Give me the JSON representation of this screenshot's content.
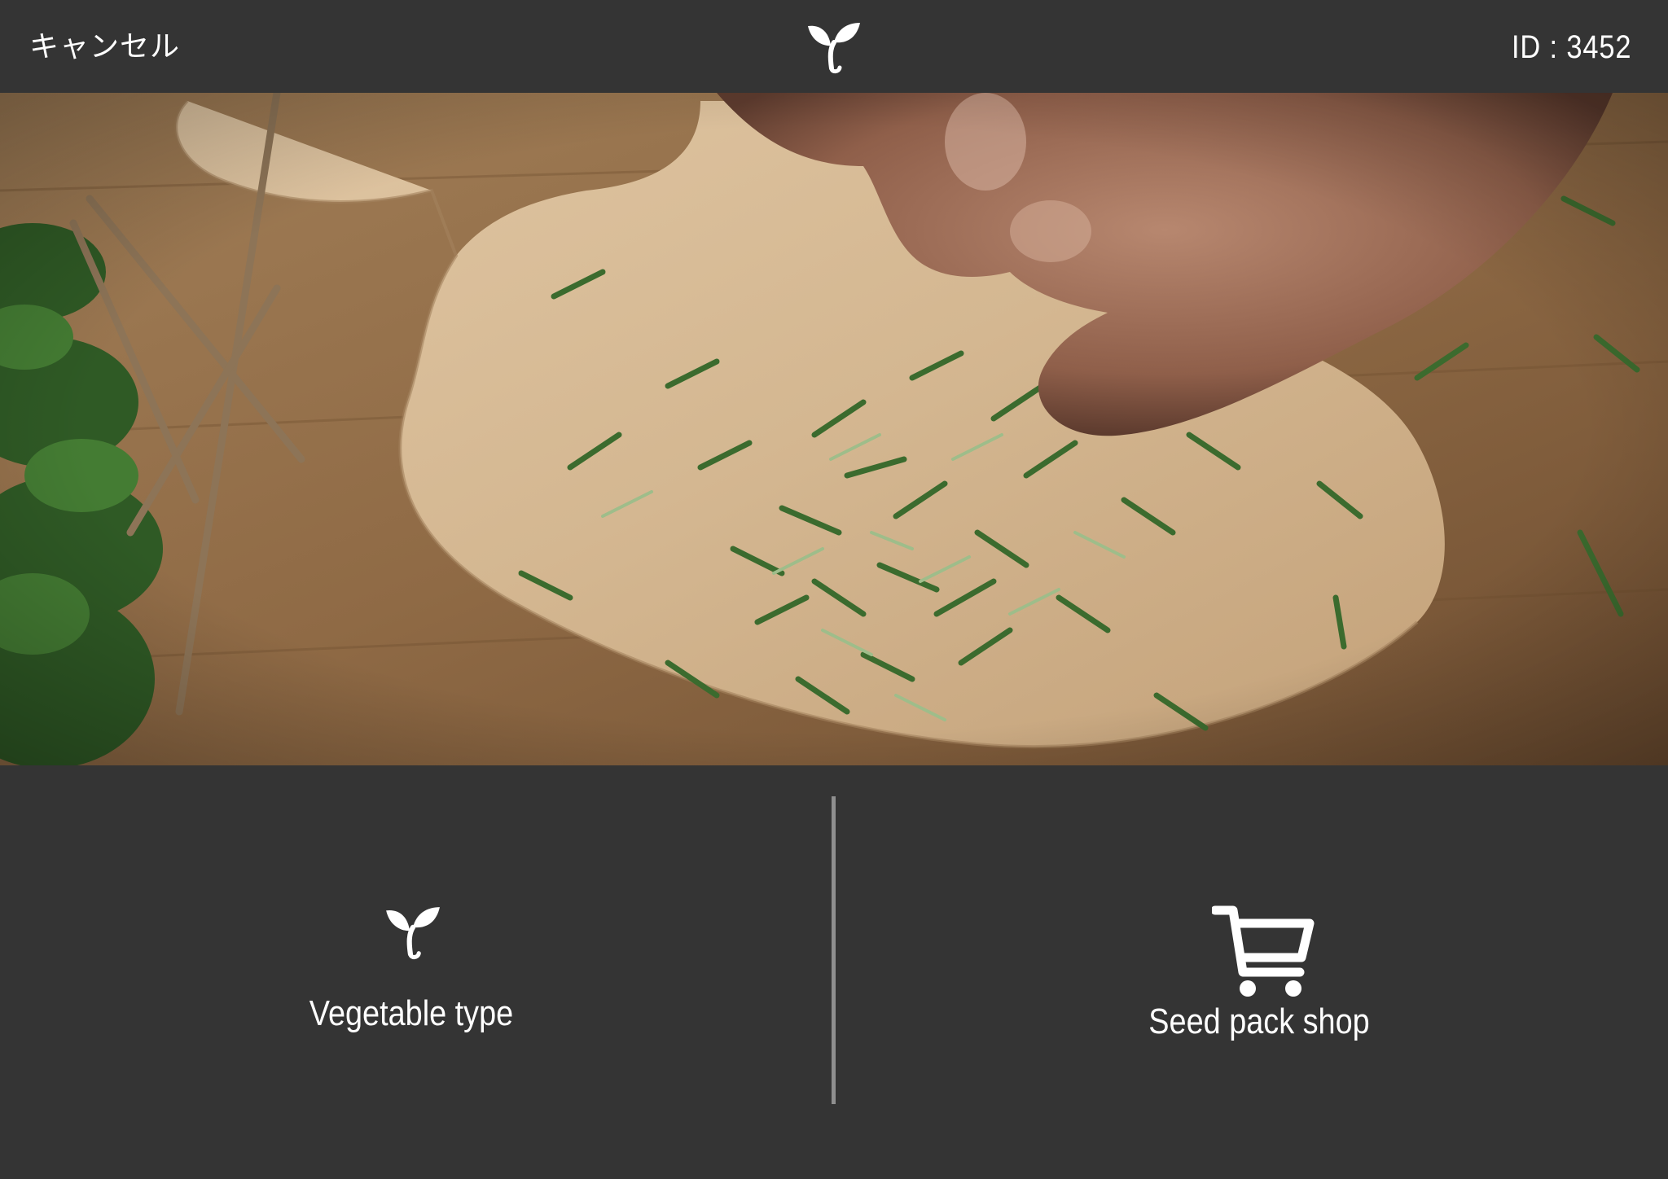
{
  "header": {
    "cancel_label": "キャンセル",
    "id_label": "ID : 3452"
  },
  "hero": {
    "icon": "rosemary-photo"
  },
  "menu": {
    "items": [
      {
        "label": "Vegetable type",
        "icon": "sprout-icon"
      },
      {
        "label": "Seed pack shop",
        "icon": "cart-icon"
      }
    ]
  },
  "colors": {
    "background": "#343434",
    "divider": "#8f8f8f",
    "text": "#ffffff"
  }
}
